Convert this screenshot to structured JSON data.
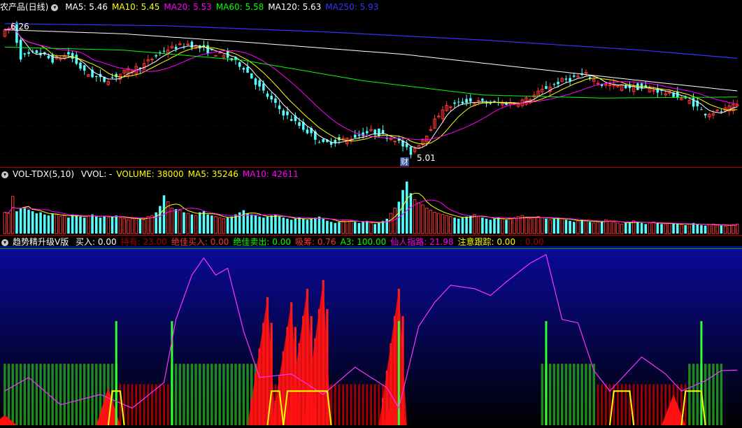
{
  "header1": {
    "title": "农产品(日线)",
    "items": [
      {
        "text": "MA5: 5.46",
        "color": "#ffffff"
      },
      {
        "text": "MA10: 5.45",
        "color": "#ffff00"
      },
      {
        "text": "MA20: 5.53",
        "color": "#ff00ff"
      },
      {
        "text": "MA60: 5.58",
        "color": "#00ff00"
      },
      {
        "text": "MA120: 5.63",
        "color": "#ffffff"
      },
      {
        "text": "MA250: 5.93",
        "color": "#3333ff"
      }
    ]
  },
  "header2": {
    "title": "VOL-TDX(5,10)",
    "items": [
      {
        "text": "VVOL: -",
        "color": "#ffffff"
      },
      {
        "text": "VOLUME: 38000",
        "color": "#ffff00"
      },
      {
        "text": "MA5: 35246",
        "color": "#ffff00"
      },
      {
        "text": "MA10: 42611",
        "color": "#ff00ff"
      }
    ]
  },
  "header3": {
    "title": "趋势精升级V版",
    "items": [
      {
        "text": "买入: 0.00",
        "color": "#ffffff"
      },
      {
        "text": "持有: 23.00",
        "color": "#aa0000"
      },
      {
        "text": "绝佳买入: 0.00",
        "color": "#ff3333"
      },
      {
        "text": "绝佳卖出: 0.00",
        "color": "#00ff00"
      },
      {
        "text": "吸筹: 0.76",
        "color": "#ff3333"
      },
      {
        "text": "A3: 100.00",
        "color": "#00ff00"
      },
      {
        "text": "仙人指路: 21.98",
        "color": "#ff00ff"
      },
      {
        "text": "注意跟踪: 0.00",
        "color": "#ffff00"
      },
      {
        "text": ": 0.00",
        "color": "#aa0000"
      }
    ]
  },
  "price_labels": {
    "high": "6.26",
    "low": "5.01",
    "marker": "财"
  },
  "colors": {
    "up": "#ff3333",
    "down": "#54ffff",
    "ma5": "#ffffff",
    "ma10": "#ffff00",
    "ma20": "#ff00ff",
    "ma60": "#00ff00",
    "ma120": "#ffffff",
    "ma250": "#3333ff",
    "separator": "#b00000"
  },
  "chart_data": [
    {
      "type": "candlestick",
      "anchors": [
        [
          0,
          6.2
        ],
        [
          2,
          6.26
        ],
        [
          4,
          5.95
        ],
        [
          8,
          6.0
        ],
        [
          12,
          5.92
        ],
        [
          16,
          5.98
        ],
        [
          20,
          5.8
        ],
        [
          25,
          5.72
        ],
        [
          30,
          5.8
        ],
        [
          35,
          5.88
        ],
        [
          40,
          6.02
        ],
        [
          46,
          6.08
        ],
        [
          52,
          6.0
        ],
        [
          56,
          5.95
        ],
        [
          60,
          5.85
        ],
        [
          64,
          5.65
        ],
        [
          70,
          5.4
        ],
        [
          75,
          5.25
        ],
        [
          80,
          5.1
        ],
        [
          86,
          5.15
        ],
        [
          92,
          5.22
        ],
        [
          98,
          5.15
        ],
        [
          102,
          5.01
        ],
        [
          106,
          5.2
        ],
        [
          110,
          5.45
        ],
        [
          116,
          5.52
        ],
        [
          122,
          5.5
        ],
        [
          128,
          5.5
        ],
        [
          132,
          5.55
        ],
        [
          136,
          5.65
        ],
        [
          140,
          5.72
        ],
        [
          146,
          5.78
        ],
        [
          150,
          5.68
        ],
        [
          156,
          5.66
        ],
        [
          162,
          5.64
        ],
        [
          168,
          5.58
        ],
        [
          172,
          5.52
        ],
        [
          176,
          5.4
        ],
        [
          180,
          5.42
        ],
        [
          184,
          5.48
        ]
      ],
      "moving_averages": [
        "MA5",
        "MA10",
        "MA20",
        "MA60",
        "MA120",
        "MA250"
      ]
    },
    {
      "type": "bar",
      "series": [
        {
          "name": "VOLUME",
          "values": [
            40,
            38,
            70,
            42,
            48,
            50,
            45,
            42,
            38,
            40,
            36,
            34,
            38,
            36,
            32,
            34,
            30,
            36,
            34,
            32,
            30,
            34,
            36,
            32,
            30,
            33,
            30,
            32,
            34,
            30,
            28,
            26,
            28,
            30,
            28,
            26,
            32,
            34,
            40,
            52,
            72,
            60,
            48,
            46,
            44,
            40,
            38,
            36,
            34,
            40,
            42,
            36,
            34,
            32,
            30,
            28,
            30,
            32,
            36,
            40,
            44,
            38,
            36,
            34,
            32,
            30,
            32,
            34,
            36,
            32,
            30,
            28,
            26,
            28,
            30,
            28,
            26,
            28,
            30,
            32,
            28,
            24,
            22,
            20,
            22,
            24,
            26,
            24,
            22,
            20,
            22,
            24,
            20,
            18,
            20,
            24,
            28,
            38,
            48,
            60,
            82,
            98,
            76,
            64,
            58,
            54,
            48,
            44,
            40,
            38,
            36,
            34,
            32,
            30,
            28,
            30,
            32,
            34,
            36,
            32,
            30,
            28,
            26,
            28,
            30,
            28,
            26,
            28,
            30,
            32,
            34,
            30,
            28,
            30,
            32,
            30,
            28,
            26,
            28,
            30,
            28,
            26,
            24,
            22,
            24,
            26,
            24,
            22,
            20,
            22,
            24,
            26,
            24,
            22,
            20,
            18,
            20,
            22,
            24,
            22,
            20,
            18,
            20,
            22,
            20,
            18,
            17,
            19,
            20,
            18,
            17,
            16,
            18,
            20,
            18,
            16,
            15,
            17,
            18,
            16,
            15,
            14,
            16,
            17,
            18
          ]
        }
      ],
      "ma_series": [
        "MA5",
        "MA10"
      ]
    },
    {
      "type": "bar",
      "series": [
        {
          "name": "A3",
          "segments": [
            [
              0,
              28
            ],
            [
              42,
              63
            ],
            [
              135,
              148
            ],
            [
              172,
              180
            ]
          ]
        },
        {
          "name": "持有",
          "segments": [
            [
              29,
              41
            ],
            [
              64,
              99
            ],
            [
              149,
              171
            ]
          ]
        },
        {
          "name": "吸筹",
          "spikes": [
            [
              66,
              0.75
            ],
            [
              72,
              0.72
            ],
            [
              76,
              0.8
            ],
            [
              80,
              0.85
            ],
            [
              99,
              0.8
            ]
          ]
        },
        {
          "name": "绝佳卖出",
          "signals": [
            28,
            42,
            99,
            136,
            175
          ]
        },
        {
          "name": "仙人指路",
          "anchors": [
            [
              0,
              0.2
            ],
            [
              6,
              0.28
            ],
            [
              14,
              0.12
            ],
            [
              24,
              0.18
            ],
            [
              32,
              0.1
            ],
            [
              40,
              0.25
            ],
            [
              43,
              0.62
            ],
            [
              47,
              0.88
            ],
            [
              50,
              0.98
            ],
            [
              53,
              0.88
            ],
            [
              56,
              0.92
            ],
            [
              60,
              0.55
            ],
            [
              64,
              0.28
            ],
            [
              72,
              0.3
            ],
            [
              80,
              0.18
            ],
            [
              88,
              0.34
            ],
            [
              96,
              0.22
            ],
            [
              99,
              0.1
            ],
            [
              104,
              0.58
            ],
            [
              108,
              0.72
            ],
            [
              112,
              0.82
            ],
            [
              118,
              0.8
            ],
            [
              122,
              0.76
            ],
            [
              126,
              0.84
            ],
            [
              132,
              0.95
            ],
            [
              136,
              1.0
            ],
            [
              140,
              0.62
            ],
            [
              144,
              0.6
            ],
            [
              148,
              0.32
            ],
            [
              152,
              0.2
            ],
            [
              160,
              0.4
            ],
            [
              166,
              0.3
            ],
            [
              170,
              0.2
            ],
            [
              176,
              0.26
            ],
            [
              180,
              0.32
            ]
          ]
        },
        {
          "name": "注意跟踪",
          "segments": [
            [
              26,
              30
            ],
            [
              66,
              70
            ],
            [
              70,
              82
            ],
            [
              152,
              158
            ],
            [
              170,
              176
            ]
          ]
        }
      ]
    }
  ]
}
